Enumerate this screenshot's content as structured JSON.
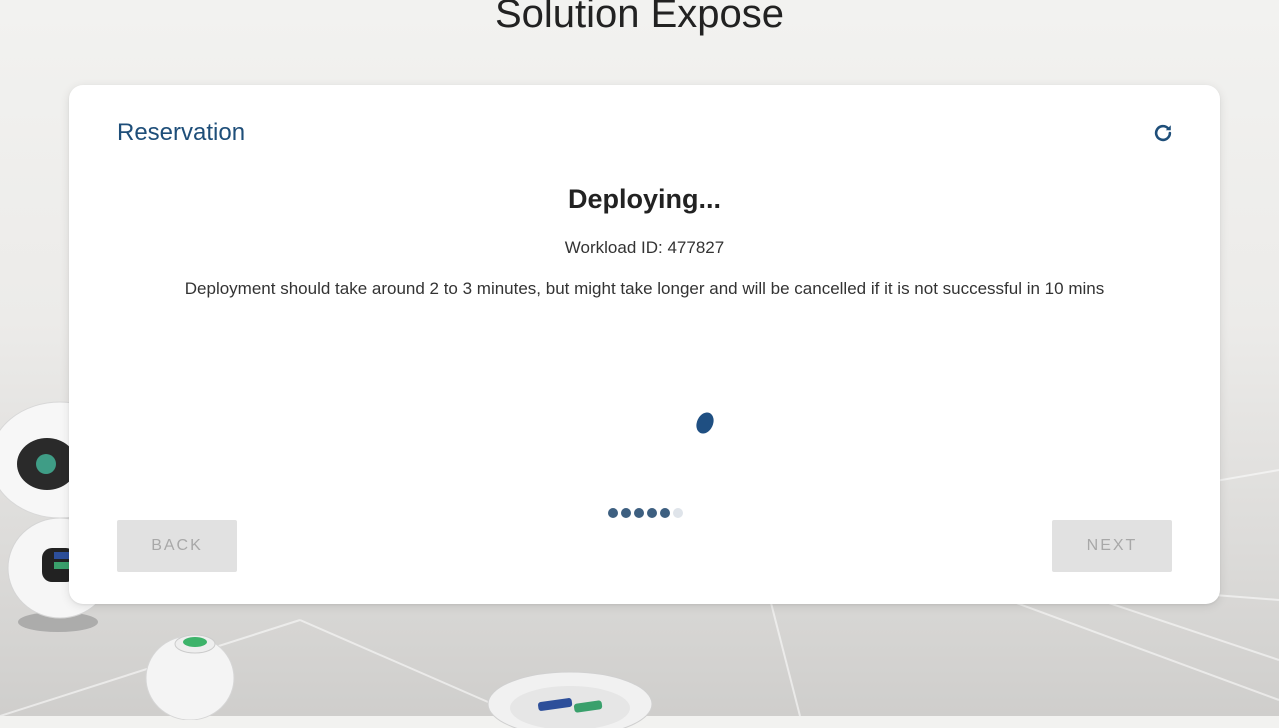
{
  "page": {
    "title": "Solution Expose"
  },
  "card": {
    "title": "Reservation",
    "refresh_icon": "refresh-icon",
    "status": "Deploying...",
    "workload_label": "Workload ID:",
    "workload_id": "477827",
    "message": "Deployment should take around 2 to 3 minutes, but might take longer and will be cancelled if it is not successful in 10 mins",
    "stepper": {
      "total_steps": 6,
      "completed_steps": 5
    },
    "buttons": {
      "back": "BACK",
      "next": "NEXT"
    }
  },
  "colors": {
    "accent": "#1e4e79",
    "spinner": "#1f4f82",
    "step_active": "#3d5f80",
    "step_inactive": "#dfe4ea",
    "button_disabled_bg": "#e1e1e1",
    "button_disabled_text": "#a8a8a8"
  }
}
